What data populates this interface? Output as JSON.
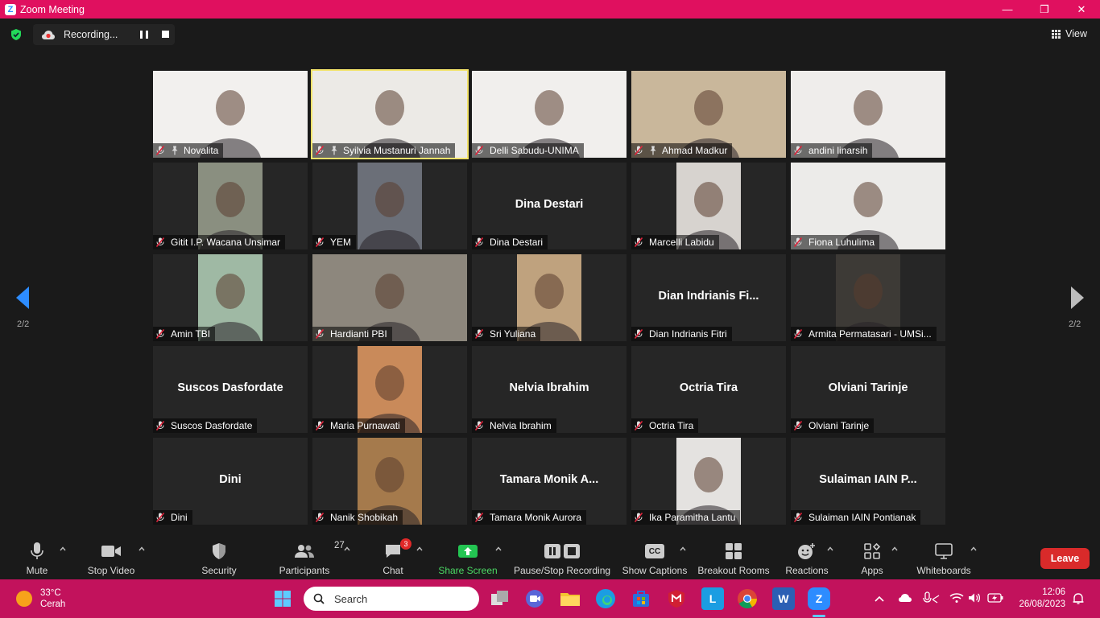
{
  "window": {
    "title": "Zoom Meeting",
    "controls": [
      "—",
      "❐",
      "✕"
    ]
  },
  "topbar": {
    "recording_label": "Recording...",
    "view_label": "View"
  },
  "gallery": {
    "page_left": "2/2",
    "page_right": "2/2",
    "tiles": [
      {
        "name": "Novalita",
        "video": true,
        "pinned": true,
        "active": false,
        "bg": "#f2f0ee"
      },
      {
        "name": "Syilvia Mustanuri Jannah",
        "video": true,
        "pinned": true,
        "active": true,
        "bg": "#eceae6"
      },
      {
        "name": "Delli Sabudu-UNIMA",
        "video": true,
        "pinned": false,
        "active": false,
        "bg": "#f1efed"
      },
      {
        "name": "Ahmad Madkur",
        "video": true,
        "pinned": true,
        "active": false,
        "bg": "#c9b79b"
      },
      {
        "name": "andini linarsih",
        "video": true,
        "pinned": false,
        "active": false,
        "bg": "#efedeb"
      },
      {
        "name": "Gitit I.P. Wacana Unsimar",
        "video": true,
        "narrow": true,
        "bg": "#8a8f80"
      },
      {
        "name": "YEM",
        "video": true,
        "narrow": true,
        "bg": "#6b6f78"
      },
      {
        "name": "Dina Destari",
        "video": false,
        "display": "Dina Destari"
      },
      {
        "name": "Marcelli Labidu",
        "video": true,
        "narrow": true,
        "bg": "#d7d3cf"
      },
      {
        "name": "Fiona Luhulima",
        "video": true,
        "bg": "#ecebe9"
      },
      {
        "name": "Amin TBI",
        "video": true,
        "narrow": true,
        "bg": "#9fb9a4"
      },
      {
        "name": "Hardianti PBI",
        "video": true,
        "bg": "#8d877d"
      },
      {
        "name": "Sri Yuliana",
        "video": true,
        "narrow": true,
        "bg": "#bfa27e"
      },
      {
        "name": "Dian Indrianis Fitri",
        "video": false,
        "display": "Dian Indrianis Fi..."
      },
      {
        "name": "Armita Permatasari - UMSi...",
        "video": true,
        "narrow": true,
        "bg": "#3d3a36"
      },
      {
        "name": "Suscos Dasfordate",
        "video": false,
        "display": "Suscos Dasfordate"
      },
      {
        "name": "Maria Purnawati",
        "video": true,
        "narrow": true,
        "bg": "#c98a5a"
      },
      {
        "name": "Nelvia Ibrahim",
        "video": false,
        "display": "Nelvia Ibrahim"
      },
      {
        "name": "Octria Tira",
        "video": false,
        "display": "Octria Tira"
      },
      {
        "name": "Olviani Tarinje",
        "video": false,
        "display": "Olviani Tarinje"
      },
      {
        "name": "Dini",
        "video": false,
        "display": "Dini"
      },
      {
        "name": "Nanik Shobikah",
        "video": true,
        "narrow": true,
        "bg": "#a57a4c"
      },
      {
        "name": "Tamara Monik Aurora",
        "video": false,
        "display": "Tamara Monik A..."
      },
      {
        "name": "Ika Paramitha Lantu",
        "video": true,
        "narrow": true,
        "bg": "#e4e2e0"
      },
      {
        "name": "Sulaiman IAIN Pontianak",
        "video": false,
        "display": "Sulaiman IAIN P..."
      }
    ]
  },
  "toolbar": {
    "mute": "Mute",
    "stop_video": "Stop Video",
    "security": "Security",
    "participants": "Participants",
    "participants_count": "27",
    "chat": "Chat",
    "chat_badge": "3",
    "share_screen": "Share Screen",
    "pause_stop_recording": "Pause/Stop Recording",
    "show_captions": "Show Captions",
    "captions_icon": "CC",
    "breakout_rooms": "Breakout Rooms",
    "reactions": "Reactions",
    "apps": "Apps",
    "whiteboards": "Whiteboards",
    "leave": "Leave"
  },
  "taskbar": {
    "temperature": "33°C",
    "condition": "Cerah",
    "search_placeholder": "Search",
    "time": "12:06",
    "date": "26/08/2023",
    "apps": [
      {
        "icon": "L",
        "color": "#1b9de2"
      },
      {
        "icon": "W",
        "color": "#2b5fb4"
      },
      {
        "icon": "Z",
        "color": "#2d8cff"
      }
    ]
  },
  "colors": {
    "accent": "#e0105f",
    "taskbar": "#c2125c",
    "active_speaker": "#f3e36a",
    "leave": "#d92a2a",
    "share_green": "#4bd964"
  }
}
